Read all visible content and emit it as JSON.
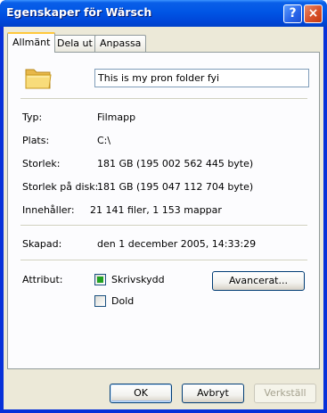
{
  "window": {
    "title": "Egenskaper för Wärsch",
    "help_glyph": "?",
    "close_glyph": "×"
  },
  "tabs": [
    {
      "label": "Allmänt",
      "active": true
    },
    {
      "label": "Dela ut",
      "active": false
    },
    {
      "label": "Anpassa",
      "active": false
    }
  ],
  "general": {
    "folder_name": "This is my pron folder fyi",
    "type_label": "Typ:",
    "type_value": "Filmapp",
    "location_label": "Plats:",
    "location_value": "C:\\",
    "size_label": "Storlek:",
    "size_value": "181 GB (195 002 562 445 byte)",
    "size_on_disk_label": "Storlek på disk:",
    "size_on_disk_value": "181 GB (195 047 112 704 byte)",
    "contains_label": "Innehåller:",
    "contains_value": "21 141 filer, 1 153 mappar",
    "created_label": "Skapad:",
    "created_value": "den 1 december 2005, 14:33:29",
    "attributes_label": "Attribut:",
    "readonly_label": "Skrivskydd",
    "readonly_checked": "indeterminate",
    "hidden_label": "Dold",
    "hidden_checked": false,
    "advanced_button": "Avancerat..."
  },
  "footer": {
    "ok": "OK",
    "cancel": "Avbryt",
    "apply": "Verkställ"
  },
  "colors": {
    "title_bar": "#0055e5",
    "dialog_face": "#ece9d8",
    "tab_highlight": "#ffc83c",
    "checkbox_fill": "#21a121"
  }
}
